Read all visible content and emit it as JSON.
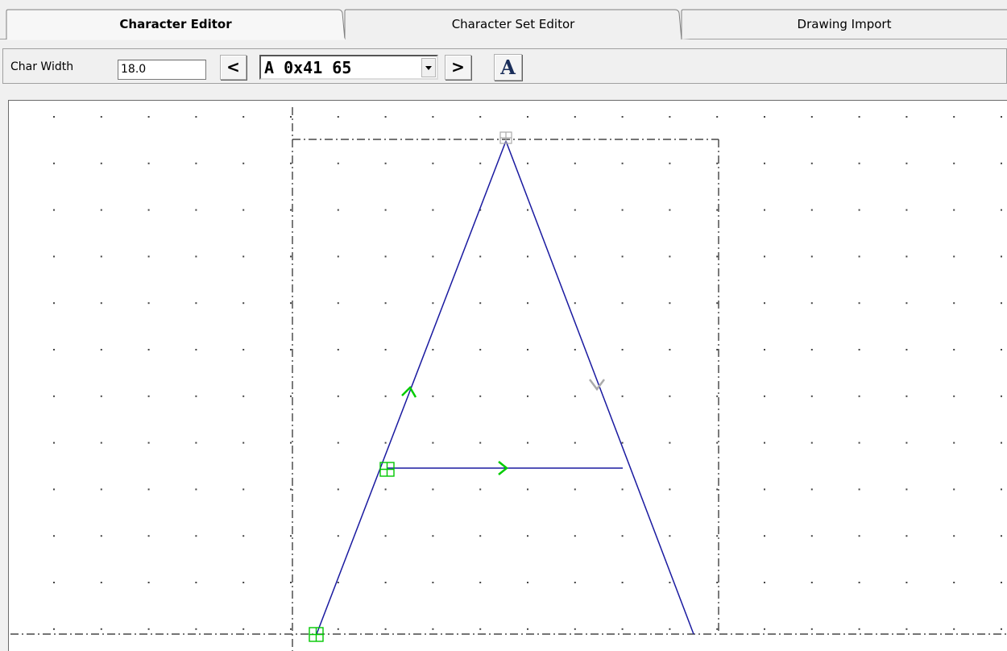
{
  "tabs": [
    {
      "label": "Character Editor",
      "active": true
    },
    {
      "label": "Character Set Editor",
      "active": false
    },
    {
      "label": "Drawing Import",
      "active": false
    }
  ],
  "toolbar": {
    "char_width_label": "Char Width",
    "char_width_value": "18.0",
    "prev_label": "<",
    "next_label": ">",
    "char_select_value": "A 0x41 65",
    "font_button_label": "A"
  },
  "colors": {
    "stroke": "#1a1aa0",
    "node_start": "#00c800",
    "node_end": "#aaaaaa",
    "direction_arrow": "#00cc00",
    "grid_dot": "#444444",
    "guide_line": "#222222"
  }
}
